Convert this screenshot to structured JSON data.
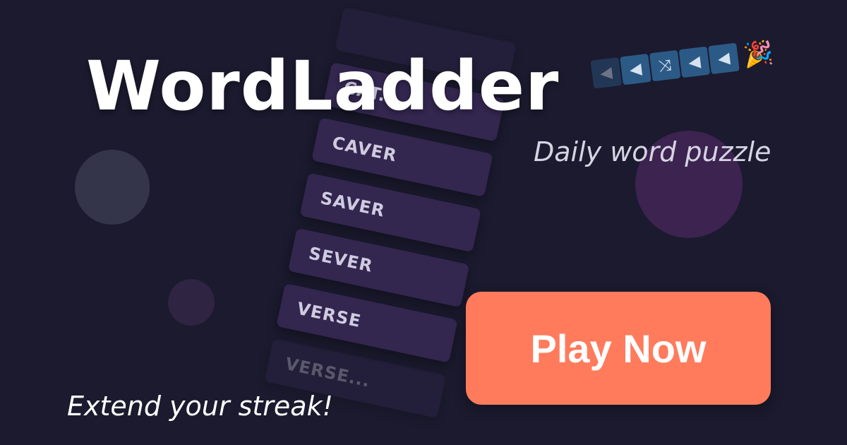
{
  "title": "WordLadder",
  "subtitle": "Daily word puzzle",
  "cta": {
    "label": "Play Now"
  },
  "tagline": "Extend your streak!",
  "ladder": {
    "words": [
      "",
      "CAT...",
      "CAVER",
      "SAVER",
      "SEVER",
      "VERSE",
      "VERSE..."
    ]
  },
  "icon_strip": {
    "icons": [
      {
        "name": "back-arrow-icon",
        "glyph": "◀"
      },
      {
        "name": "back-arrow-icon",
        "glyph": "◀"
      },
      {
        "name": "shuffle-icon",
        "glyph": "⤨"
      },
      {
        "name": "back-arrow-icon",
        "glyph": "◀"
      },
      {
        "name": "back-arrow-icon",
        "glyph": "◀"
      }
    ],
    "party_glyph": "🎉"
  },
  "colors": {
    "background": "#1b1a2e",
    "cta": "#ff7b5c",
    "card": "#33264f",
    "strip_tile": "#2c5a86"
  }
}
